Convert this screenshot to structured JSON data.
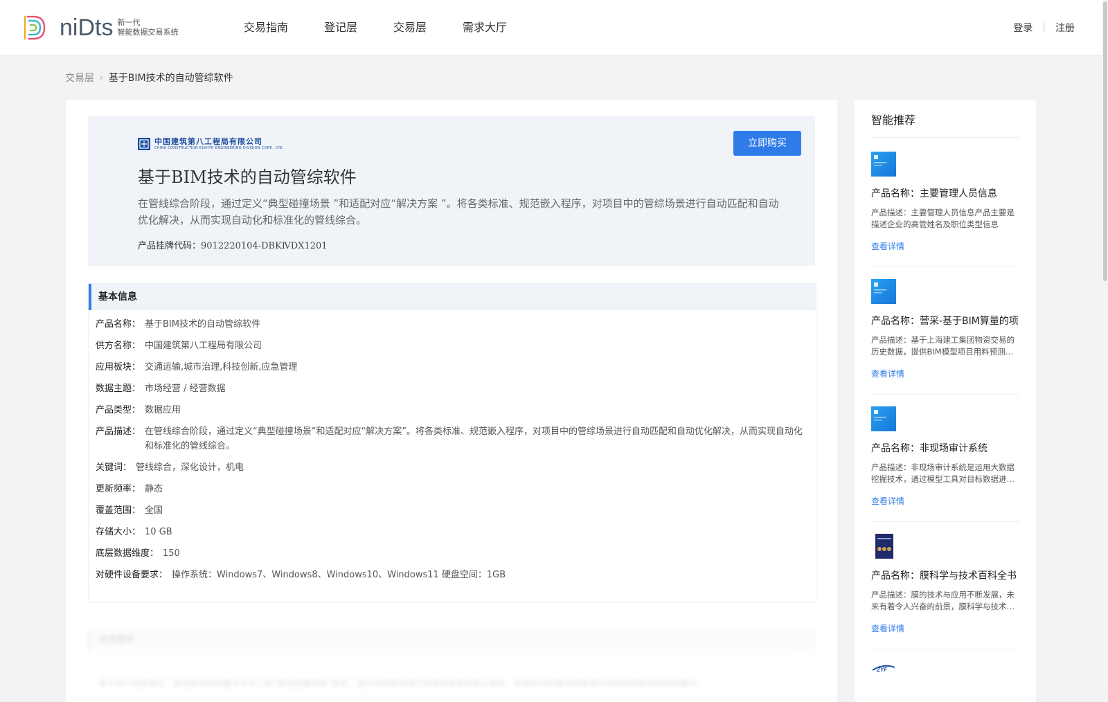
{
  "header": {
    "logo_word": "niDts",
    "logo_sub_line1": "新一代",
    "logo_sub_line2": "智能数据交易系统",
    "nav": [
      "交易指南",
      "登记层",
      "交易层",
      "需求大厅"
    ],
    "login": "登录",
    "register": "注册"
  },
  "breadcrumb": {
    "parent": "交易层",
    "arrow": "›",
    "current": "基于BIM技术的自动管综软件"
  },
  "hero": {
    "company_logo_cn": "中国建筑第八工程局有限公司",
    "company_logo_en": "CHINA CONSTRUCTION EIGHTH ENGINEERING DIVISION CORP., LTD.",
    "buy_label": "立即购买",
    "title": "基于BIM技术的自动管综软件",
    "description": "在管线综合阶段，通过定义“典型碰撞场景 ”和适配对应“解决方案 ”。将各类标准、规范嵌入程序，对项目中的管综场景进行自动匹配和自动优化解决，从而实现自动化和标准化的管线综合。",
    "code_label": "产品挂牌代码：",
    "code_value": "9012220104-DBKⅣDX1201"
  },
  "basic_info": {
    "title": "基本信息",
    "rows": [
      {
        "label": "产品名称：",
        "value": "基于BIM技术的自动管综软件"
      },
      {
        "label": "供方名称：",
        "value": "中国建筑第八工程局有限公司"
      },
      {
        "label": "应用板块：",
        "value": "交通运输,城市治理,科技创新,应急管理"
      },
      {
        "label": "数据主题：",
        "value": "市场经营 / 经营数据"
      },
      {
        "label": "产品类型：",
        "value": "数据应用"
      },
      {
        "label": "产品描述：",
        "value": "在管线综合阶段，通过定义“典型碰撞场景”和适配对应“解决方案”。将各类标准、规范嵌入程序，对项目中的管综场景进行自动匹配和自动优化解决，从而实现自动化和标准化的管线综合。"
      },
      {
        "label": "关键词：",
        "value": "管线综合，深化设计，机电"
      },
      {
        "label": "更新频率：",
        "value": "静态"
      },
      {
        "label": "覆盖范围：",
        "value": "全国"
      },
      {
        "label": "存储大小：",
        "value": "10 GB"
      },
      {
        "label": "底层数据维度：",
        "value": "150"
      },
      {
        "label": "对硬件设备要求：",
        "value": "操作系统：Windows7、Windows8、Windows10、Windows11 硬盘空间：1GB"
      }
    ]
  },
  "blurred_section": {
    "title": "使用案例",
    "line": "基于本产品能够在，管线综合阶段整合平台上按“典型碰撞场景”需求，通过调用算法进行各类标准规范嵌入程序，对项目中的管综场景进行自动匹配和自动优化解决。"
  },
  "sidebar": {
    "title": "智能推荐",
    "link_label": "查看详情",
    "items": [
      {
        "name": "产品名称：主要管理人员信息",
        "desc": "产品描述：主要管理人员信息产品主要是描述企业的高管姓名及职位类型信息",
        "thumb": "blue-doc-thumbnail"
      },
      {
        "name": "产品名称：营采-基于BIM算量的项目",
        "desc": "产品描述：基于上海建工集团物资交易的历史数据，提供BIM模型项目用料预测等服务",
        "thumb": "blue-doc-thumbnail"
      },
      {
        "name": "产品名称：非现场审计系统",
        "desc": "产品描述：非现场审计系统是运用大数据挖掘技术，通过模型工具对目标数据进行分析",
        "thumb": "blue-doc-thumbnail"
      },
      {
        "name": "产品名称：膜科学与技术百科全书",
        "desc": "产品描述：膜的技术与应用不断发展，未来有着令人兴奋的前景，膜科学与技术的发展",
        "thumb": "book-cover-thumbnail"
      }
    ],
    "partial_logo": "ZYF"
  },
  "colors": {
    "accent": "#2f7bea",
    "page_bg": "#f2f3f5",
    "hero_bg": "#f0f4f9"
  }
}
